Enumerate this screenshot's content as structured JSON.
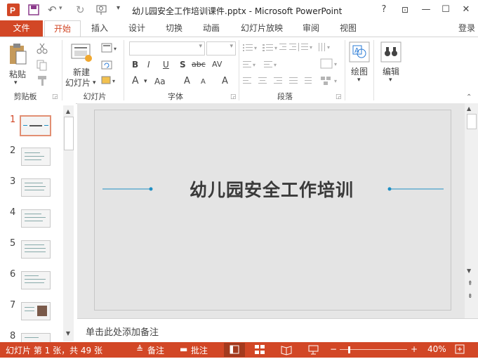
{
  "window": {
    "title": "幼儿园安全工作培训课件.pptx - Microsoft PowerPoint",
    "help": "?",
    "ribbon_display": "⊡",
    "minimize": "—",
    "maximize": "☐",
    "close": "✕"
  },
  "qat": {
    "undo": "↶",
    "redo": "↻",
    "customize": "▾"
  },
  "tabs": [
    {
      "label": "文件"
    },
    {
      "label": "开始"
    },
    {
      "label": "插入"
    },
    {
      "label": "设计"
    },
    {
      "label": "切换"
    },
    {
      "label": "动画"
    },
    {
      "label": "幻灯片放映"
    },
    {
      "label": "审阅"
    },
    {
      "label": "视图"
    }
  ],
  "signin": "登录",
  "ribbon": {
    "clipboard": {
      "paste": "粘贴",
      "label": "剪贴板"
    },
    "slides": {
      "new_slide_line1": "新建",
      "new_slide_line2": "幻灯片",
      "label": "幻灯片"
    },
    "font": {
      "label": "字体",
      "bold": "B",
      "italic": "I",
      "underline": "U",
      "shadow": "S",
      "strike": "abc",
      "spacing": "AV",
      "grow": "A",
      "shrink": "A",
      "case": "Aa",
      "clear": "A"
    },
    "paragraph": {
      "label": "段落"
    },
    "drawing": {
      "label": "绘图"
    },
    "editing": {
      "label": "编辑"
    }
  },
  "slides": [
    {
      "num": "1"
    },
    {
      "num": "2"
    },
    {
      "num": "3"
    },
    {
      "num": "4"
    },
    {
      "num": "5"
    },
    {
      "num": "6"
    },
    {
      "num": "7"
    },
    {
      "num": "8"
    }
  ],
  "slide": {
    "title": "幼儿园安全工作培训"
  },
  "notes": {
    "placeholder": "单击此处添加备注"
  },
  "status": {
    "slide_info": "幻灯片 第 1 张，共 49 张",
    "notes": "备注",
    "comments": "批注",
    "zoom": "40%"
  },
  "colors": {
    "accent": "#d24726",
    "line": "#1f8fc4"
  }
}
